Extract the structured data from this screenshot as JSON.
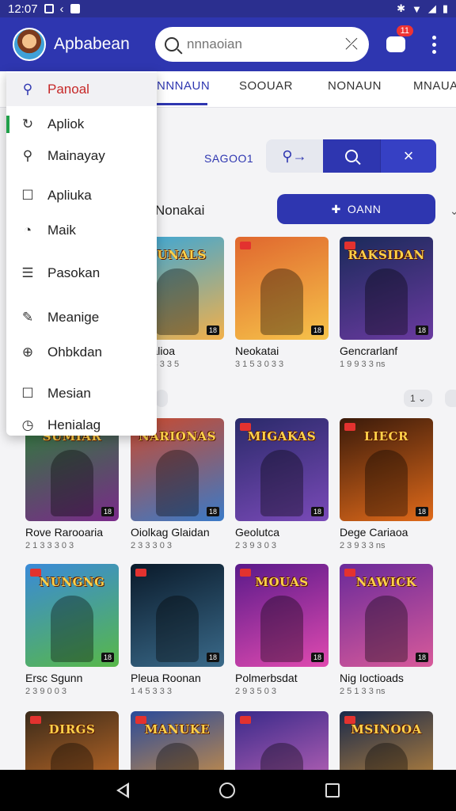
{
  "status_bar": {
    "time": "12:07"
  },
  "app": {
    "title": "Apbabean"
  },
  "search": {
    "placeholder": "nnnaoian"
  },
  "notifications": {
    "count": "11"
  },
  "tabs": [
    {
      "label": "NNNAUN",
      "active": true
    },
    {
      "label": "SOOUAR",
      "active": false
    },
    {
      "label": "NONAUN",
      "active": false
    },
    {
      "label": "MNAUA",
      "active": false
    }
  ],
  "controls": {
    "sort_label": "SAGOO1",
    "add_label": "OANN"
  },
  "section": {
    "title": "Nonakai"
  },
  "row_chips": [
    "1 ⌄"
  ],
  "drawer": {
    "items": [
      {
        "label": "Panoal",
        "icon": "search-icon",
        "glyph": "⚲"
      },
      {
        "label": "Apliok",
        "icon": "refresh-icon",
        "glyph": "↻"
      },
      {
        "label": "Mainayay",
        "icon": "search-icon",
        "glyph": "⚲"
      },
      {
        "label": "Apliuka",
        "icon": "checkbox-icon",
        "glyph": "☐"
      },
      {
        "label": "Maik",
        "icon": "chat-icon",
        "glyph": "◔"
      },
      {
        "label": "Pasokan",
        "icon": "storage-icon",
        "glyph": "☰"
      },
      {
        "label": "Meanige",
        "icon": "edit-icon",
        "glyph": "✎"
      },
      {
        "label": "Ohbkdan",
        "icon": "globe-icon",
        "glyph": "⊕"
      },
      {
        "label": "Mesian",
        "icon": "checkbox-icon",
        "glyph": "☐"
      },
      {
        "label": "Henialag",
        "icon": "clock-icon",
        "glyph": "◷"
      }
    ]
  },
  "games": [
    {
      "title": "",
      "sub": "",
      "logo": ""
    },
    {
      "title": "Onealioa",
      "sub": "1 4 0 3 3 3 5",
      "logo": "SUNALS"
    },
    {
      "title": "Neokatai",
      "sub": "3 1 5 3 0 3 3",
      "logo": ""
    },
    {
      "title": "Gencrarlanf",
      "sub": "1 9 9 3 3 ns",
      "logo": "RAKSIDAN"
    },
    {
      "title": "Rove Rarooaria",
      "sub": "2 1 3 3 3 0 3",
      "logo": "SUMIAR"
    },
    {
      "title": "Oiolkag Glaidan",
      "sub": "2 3 3 3 0 3",
      "logo": "NARIONAS"
    },
    {
      "title": "Geolutca",
      "sub": "2 3 9 3 0 3",
      "logo": "MIGAKAS"
    },
    {
      "title": "Dege Cariaoa",
      "sub": "2 3 9 3 3 ns",
      "logo": "LIECR"
    },
    {
      "title": "Ersc Sgunn",
      "sub": "2 3 9 0 0 3",
      "logo": "NUNGNG"
    },
    {
      "title": "Pleua Roonan",
      "sub": "1 4 5 3 3 3",
      "logo": ""
    },
    {
      "title": "Polmerbsdat",
      "sub": "2 9 3 5 0 3",
      "logo": "MOUAS"
    },
    {
      "title": "Nig Ioctioads",
      "sub": "2 5 1 3 3 ns",
      "logo": "NAWICK"
    },
    {
      "title": "",
      "sub": "",
      "logo": "DIRGS"
    },
    {
      "title": "",
      "sub": "",
      "logo": "MANUKE"
    },
    {
      "title": "",
      "sub": "",
      "logo": ""
    },
    {
      "title": "",
      "sub": "",
      "logo": "MSINOOA"
    }
  ],
  "colors": {
    "primary": "#2e36b0",
    "status_bar": "#2b2f8f",
    "accent_red": "#c62828"
  }
}
